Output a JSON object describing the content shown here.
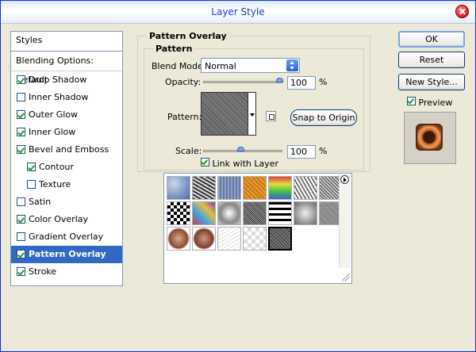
{
  "window": {
    "title": "Layer Style"
  },
  "sidebar": {
    "header": "Styles",
    "blending_default": "Blending Options: Default",
    "items": [
      {
        "label": "Drop Shadow",
        "checked": true,
        "sub": false,
        "selected": false
      },
      {
        "label": "Inner Shadow",
        "checked": false,
        "sub": false,
        "selected": false
      },
      {
        "label": "Outer Glow",
        "checked": true,
        "sub": false,
        "selected": false
      },
      {
        "label": "Inner Glow",
        "checked": true,
        "sub": false,
        "selected": false
      },
      {
        "label": "Bevel and Emboss",
        "checked": true,
        "sub": false,
        "selected": false
      },
      {
        "label": "Contour",
        "checked": true,
        "sub": true,
        "selected": false
      },
      {
        "label": "Texture",
        "checked": false,
        "sub": true,
        "selected": false
      },
      {
        "label": "Satin",
        "checked": false,
        "sub": false,
        "selected": false
      },
      {
        "label": "Color Overlay",
        "checked": true,
        "sub": false,
        "selected": false
      },
      {
        "label": "Gradient Overlay",
        "checked": false,
        "sub": false,
        "selected": false
      },
      {
        "label": "Pattern Overlay",
        "checked": true,
        "sub": false,
        "selected": true
      },
      {
        "label": "Stroke",
        "checked": true,
        "sub": false,
        "selected": false
      }
    ]
  },
  "pattern_overlay": {
    "group_title": "Pattern Overlay",
    "section_title": "Pattern",
    "blend_mode_label": "Blend Mode:",
    "blend_mode_value": "Normal",
    "opacity_label": "Opacity:",
    "opacity_value": "100",
    "opacity_unit": "%",
    "pattern_label": "Pattern:",
    "snap_button": "Snap to Origin",
    "scale_label": "Scale:",
    "scale_value": "100",
    "scale_unit": "%",
    "link_label": "Link with Layer",
    "link_checked": true
  },
  "buttons": {
    "ok": "OK",
    "reset": "Reset",
    "new_style": "New Style...",
    "preview": "Preview",
    "preview_checked": true
  },
  "pattern_picker": {
    "selected_index": 18,
    "icons": [
      "pattern-picker-menu-icon"
    ]
  }
}
